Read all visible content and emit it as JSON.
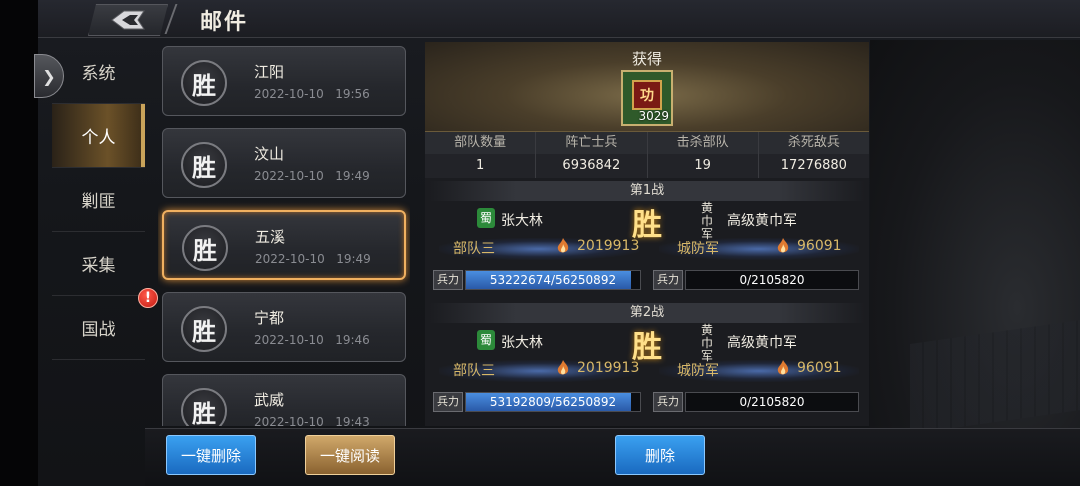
{
  "header": {
    "title": "邮件"
  },
  "sidebar": {
    "items": [
      {
        "label": "系统",
        "active": false
      },
      {
        "label": "个人",
        "active": true
      },
      {
        "label": "剿匪",
        "active": false
      },
      {
        "label": "采集",
        "active": false
      },
      {
        "label": "国战",
        "active": false,
        "badge": "!"
      }
    ]
  },
  "mail_list": [
    {
      "icon_text": "胜",
      "name": "江阳",
      "date": "2022-10-10",
      "time": "19:56"
    },
    {
      "icon_text": "胜",
      "name": "汶山",
      "date": "2022-10-10",
      "time": "19:49"
    },
    {
      "icon_text": "胜",
      "name": "五溪",
      "date": "2022-10-10",
      "time": "19:49",
      "selected": true
    },
    {
      "icon_text": "胜",
      "name": "宁都",
      "date": "2022-10-10",
      "time": "19:46"
    },
    {
      "icon_text": "胜",
      "name": "武威",
      "date": "2022-10-10",
      "time": "19:43"
    }
  ],
  "detail": {
    "reward_title": "获得",
    "reward_item": {
      "seal_text": "功",
      "count": "3029"
    },
    "stats": {
      "headers": [
        "部队数量",
        "阵亡士兵",
        "击杀部队",
        "杀死敌兵"
      ],
      "values": [
        "1",
        "6936842",
        "19",
        "17276880"
      ]
    },
    "hp_label": "兵力",
    "battles": [
      {
        "title": "第1战",
        "result_mark": "胜",
        "attacker": {
          "faction": "蜀",
          "general": "张大林",
          "troop": "部队三",
          "power": "2019913",
          "hp": "53222674/56250892",
          "hp_ratio": 0.946
        },
        "defender": {
          "faction": "黄巾军",
          "general": "高级黄巾军",
          "troop": "城防军",
          "power": "96091",
          "hp": "0/2105820",
          "hp_ratio": 0
        }
      },
      {
        "title": "第2战",
        "result_mark": "胜",
        "attacker": {
          "faction": "蜀",
          "general": "张大林",
          "troop": "部队三",
          "power": "2019913",
          "hp": "53192809/56250892",
          "hp_ratio": 0.946
        },
        "defender": {
          "faction": "黄巾军",
          "general": "高级黄巾军",
          "troop": "城防军",
          "power": "96091",
          "hp": "0/2105820",
          "hp_ratio": 0
        }
      }
    ]
  },
  "footer": {
    "delete_all": "一键删除",
    "read_all": "一键阅读",
    "delete": "删除"
  },
  "colors": {
    "accent_gold": "#f0b060",
    "button_blue": "#2a86d8",
    "hp_blue": "#3a7ed0",
    "win_gold": "#ffe08a"
  }
}
